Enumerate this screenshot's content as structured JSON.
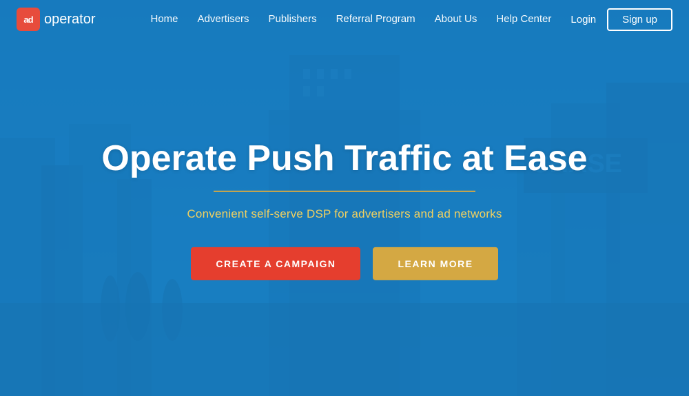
{
  "logo": {
    "icon_text": "ad",
    "text": "operator"
  },
  "navbar": {
    "links": [
      {
        "label": "Home",
        "href": "#"
      },
      {
        "label": "Advertisers",
        "href": "#"
      },
      {
        "label": "Publishers",
        "href": "#"
      },
      {
        "label": "Referral Program",
        "href": "#"
      },
      {
        "label": "About Us",
        "href": "#"
      },
      {
        "label": "Help Center",
        "href": "#"
      }
    ],
    "login_label": "Login",
    "signup_label": "Sign up"
  },
  "hero": {
    "title": "Operate Push Traffic at Ease",
    "subtitle": "Convenient self-serve DSP for advertisers and ad networks",
    "button_campaign": "CREATE A CAMPAIGN",
    "button_learn": "LEARN MORE"
  },
  "colors": {
    "accent_red": "#e53e2e",
    "accent_yellow": "#d4a843",
    "nav_bg": "transparent",
    "hero_bg": "#1a7fc1"
  }
}
